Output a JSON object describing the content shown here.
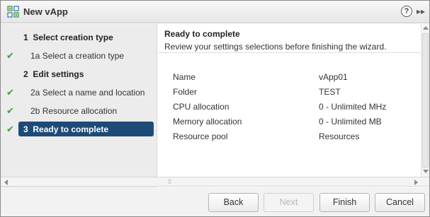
{
  "window": {
    "title": "New vApp",
    "icon": "vapp-icon",
    "help_symbol": "?",
    "expand_symbol": "▸▸"
  },
  "nav": {
    "items": [
      {
        "number": "1",
        "label": "Select creation type",
        "kind": "heading",
        "completed": false,
        "active": false
      },
      {
        "number": "1a",
        "label": "Select a creation type",
        "kind": "sub",
        "completed": true,
        "active": false
      },
      {
        "number": "2",
        "label": "Edit settings",
        "kind": "heading",
        "completed": false,
        "active": false
      },
      {
        "number": "2a",
        "label": "Select a name and location",
        "kind": "sub",
        "completed": true,
        "active": false
      },
      {
        "number": "2b",
        "label": "Resource allocation",
        "kind": "sub",
        "completed": true,
        "active": false
      },
      {
        "number": "3",
        "label": "Ready to complete",
        "kind": "heading",
        "completed": true,
        "active": true
      }
    ],
    "check_symbol": "✔"
  },
  "content": {
    "title": "Ready to complete",
    "subtitle": "Review your settings selections before finishing the wizard.",
    "summary": [
      {
        "key": "Name",
        "value": "vApp01"
      },
      {
        "key": "Folder",
        "value": "TEST"
      },
      {
        "key": "CPU allocation",
        "value": "0 - Unlimited MHz"
      },
      {
        "key": "Memory allocation",
        "value": "0 - Unlimited MB"
      },
      {
        "key": "Resource pool",
        "value": "Resources"
      }
    ]
  },
  "footer": {
    "back_label": "Back",
    "next_label": "Next",
    "finish_label": "Finish",
    "cancel_label": "Cancel",
    "next_disabled": true
  },
  "colors": {
    "active_bg": "#1e4a78",
    "check": "#3f9d3f"
  }
}
